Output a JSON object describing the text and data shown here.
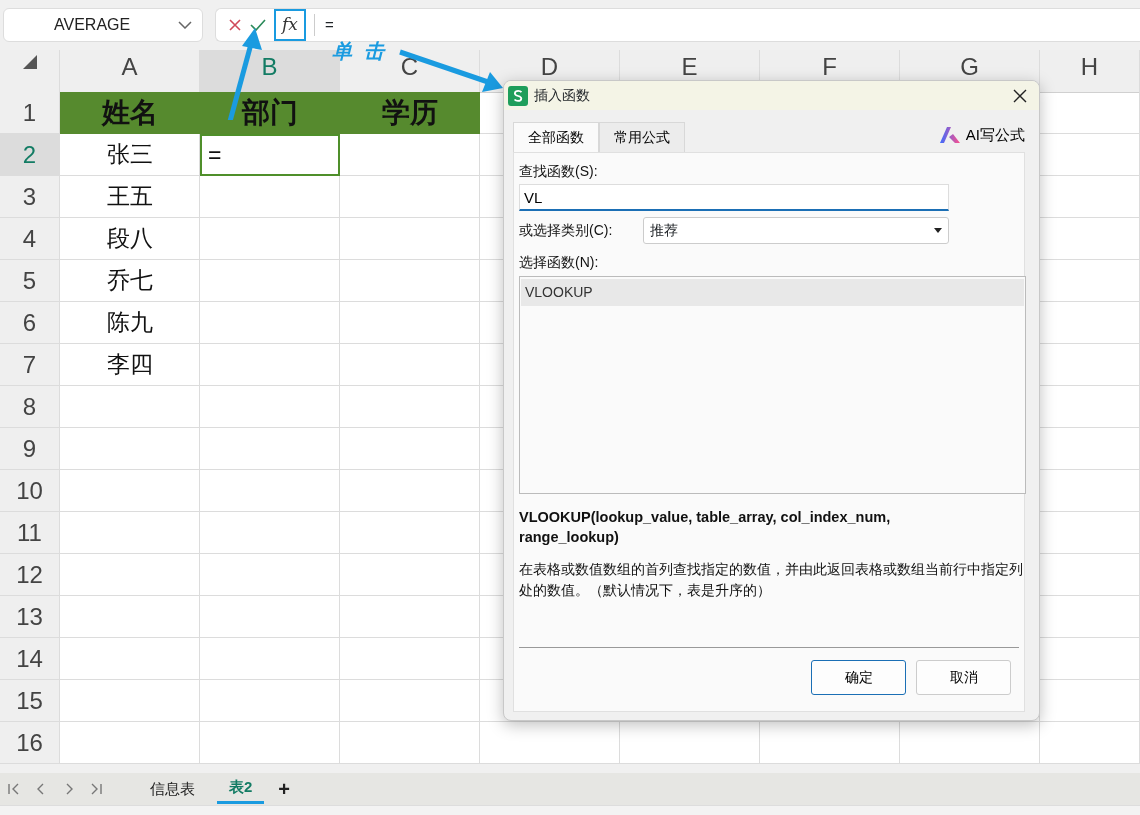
{
  "name_box": {
    "value": "AVERAGE"
  },
  "formula_bar": {
    "fx": "fx",
    "value": "="
  },
  "annotation": {
    "text": "单击"
  },
  "columns": [
    {
      "label": "A",
      "selected": false
    },
    {
      "label": "B",
      "selected": true
    },
    {
      "label": "C",
      "selected": false
    },
    {
      "label": "D",
      "selected": false
    },
    {
      "label": "E",
      "selected": false
    },
    {
      "label": "F",
      "selected": false
    },
    {
      "label": "G",
      "selected": false
    },
    {
      "label": "H",
      "selected": false
    }
  ],
  "rows": [
    {
      "number": "1",
      "selected": false,
      "kind": "header",
      "cells": [
        "姓名",
        "部门",
        "学历"
      ]
    },
    {
      "number": "2",
      "selected": true,
      "kind": "data",
      "cells": [
        {
          "text": "张三",
          "active": false
        },
        {
          "text": "=",
          "active": true
        }
      ]
    },
    {
      "number": "3",
      "selected": false,
      "kind": "data",
      "cells": [
        "王五"
      ]
    },
    {
      "number": "4",
      "selected": false,
      "kind": "data",
      "cells": [
        "段八"
      ]
    },
    {
      "number": "5",
      "selected": false,
      "kind": "data",
      "cells": [
        "乔七"
      ]
    },
    {
      "number": "6",
      "selected": false,
      "kind": "data",
      "cells": [
        "陈九"
      ]
    },
    {
      "number": "7",
      "selected": false,
      "kind": "data",
      "cells": [
        "李四"
      ]
    },
    {
      "number": "8",
      "selected": false,
      "kind": "data",
      "cells": []
    },
    {
      "number": "9",
      "selected": false,
      "kind": "data",
      "cells": []
    },
    {
      "number": "10",
      "selected": false,
      "kind": "data",
      "cells": []
    },
    {
      "number": "11",
      "selected": false,
      "kind": "data",
      "cells": []
    },
    {
      "number": "12",
      "selected": false,
      "kind": "data",
      "cells": []
    },
    {
      "number": "13",
      "selected": false,
      "kind": "data",
      "cells": []
    },
    {
      "number": "14",
      "selected": false,
      "kind": "data",
      "cells": []
    },
    {
      "number": "15",
      "selected": false,
      "kind": "data",
      "cells": []
    },
    {
      "number": "16",
      "selected": false,
      "kind": "data",
      "cells": []
    }
  ],
  "dialog": {
    "title": "插入函数",
    "tabs": [
      {
        "label": "全部函数",
        "selected": true
      },
      {
        "label": "常用公式",
        "selected": false
      }
    ],
    "ai_button": "AI写公式",
    "search_label": "查找函数(S):",
    "search_value": "VL",
    "category_label": "或选择类别(C):",
    "category_value": "推荐",
    "list_label": "选择函数(N):",
    "functions": [
      {
        "name": "VLOOKUP",
        "selected": true
      }
    ],
    "signature": "VLOOKUP(lookup_value, table_array, col_index_num, range_lookup)",
    "description": "在表格或数值数组的首列查找指定的数值，并由此返回表格或数组当前行中指定列处的数值。（默认情况下，表是升序的）",
    "buttons": [
      {
        "label": "确定",
        "default": true
      },
      {
        "label": "取消",
        "default": false
      }
    ]
  },
  "sheet_tabs": [
    {
      "label": "信息表",
      "selected": false
    },
    {
      "label": "表2",
      "selected": true
    }
  ],
  "add_sheet": "+"
}
